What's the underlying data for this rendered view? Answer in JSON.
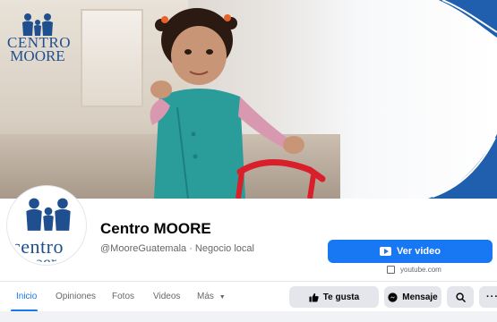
{
  "cover": {
    "logo_line1": "CENTRO",
    "logo_line2": "MOORE"
  },
  "profile": {
    "avatar_line1": "centro",
    "avatar_line2": "moor",
    "name": "Centro MOORE",
    "subtitle": "@MooreGuatemala · Negocio local"
  },
  "cta": {
    "label": "Ver video",
    "link_text": "youtube.com"
  },
  "tabs": [
    {
      "label": "Inicio",
      "active": true
    },
    {
      "label": "Opiniones",
      "active": false
    },
    {
      "label": "Fotos",
      "active": false
    },
    {
      "label": "Videos",
      "active": false
    },
    {
      "label": "Más",
      "active": false
    }
  ],
  "actions": {
    "like_label": "Te gusta",
    "message_label": "Mensaje",
    "search_icon": "search-icon",
    "more_icon": "ellipsis-icon"
  },
  "colors": {
    "brand_blue": "#1877f2",
    "logo_blue": "#1f4f8f"
  }
}
